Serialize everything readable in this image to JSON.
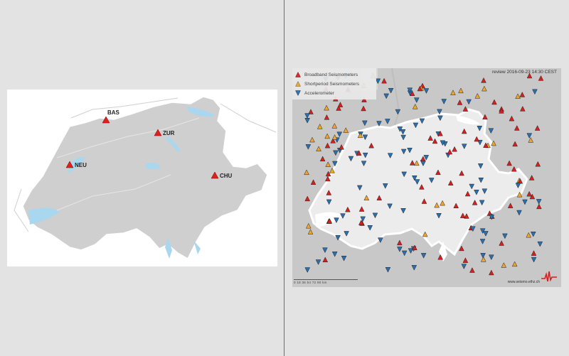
{
  "left_map": {
    "stations": [
      {
        "code": "BAS"
      },
      {
        "code": "ZUR"
      },
      {
        "code": "NEU"
      },
      {
        "code": "CHU"
      }
    ],
    "colors": {
      "marker": "#e21f1f",
      "land": "#cfcfcf",
      "lake": "#a9d7ef",
      "border": "#ffffff"
    }
  },
  "right_map": {
    "legend": [
      {
        "label": "Broadband Seismometers",
        "icon": "triangle-up-red-icon"
      },
      {
        "label": "Shortperiod Seismometers",
        "icon": "triangle-up-orange-icon"
      },
      {
        "label": "Accelerometer",
        "icon": "triangle-down-blue-icon"
      }
    ],
    "review_text": "review 2016-09-23 14:30 CEST",
    "scale_text": "0    18    36    54    72    90 km",
    "credit": "www.seismo.ethz.ch",
    "colors": {
      "broadband": "#d81e1e",
      "shortperiod": "#f0a52a",
      "accelerometer": "#2a6fb0"
    }
  }
}
